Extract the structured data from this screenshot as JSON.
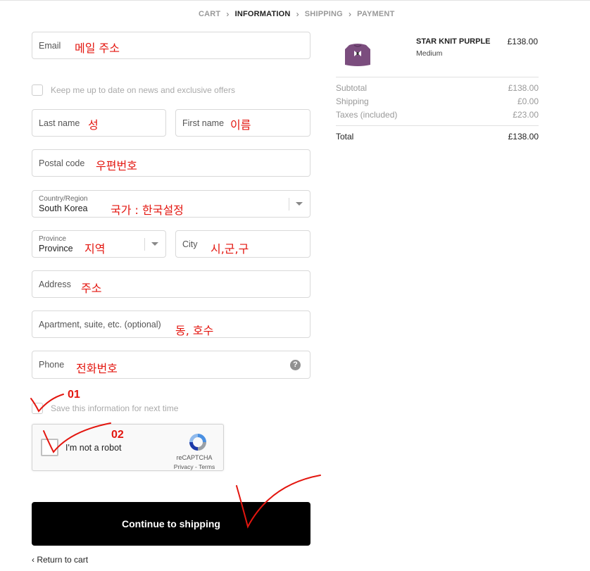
{
  "breadcrumb": [
    {
      "label": "CART",
      "active": false
    },
    {
      "label": "INFORMATION",
      "active": true
    },
    {
      "label": "SHIPPING",
      "active": false
    },
    {
      "label": "PAYMENT",
      "active": false
    }
  ],
  "form": {
    "email": {
      "placeholder": "Email",
      "annotation": "메일 주소"
    },
    "newsletter": {
      "label": "Keep me up to date on news and exclusive offers",
      "checked": false
    },
    "last_name": {
      "placeholder": "Last name",
      "annotation": "성"
    },
    "first_name": {
      "placeholder": "First name",
      "annotation": "이름"
    },
    "postal_code": {
      "placeholder": "Postal code",
      "annotation": "우편번호"
    },
    "country": {
      "label": "Country/Region",
      "value": "South Korea",
      "annotation": "국가 : 한국설정"
    },
    "province": {
      "label": "Province",
      "value": "Province",
      "annotation": "지역"
    },
    "city": {
      "placeholder": "City",
      "annotation": "시,군,구"
    },
    "address": {
      "placeholder": "Address",
      "annotation": "주소"
    },
    "apartment": {
      "placeholder": "Apartment, suite, etc. (optional)",
      "annotation": "동, 호수"
    },
    "phone": {
      "placeholder": "Phone",
      "annotation": "전화번호",
      "help_icon": "question-icon"
    },
    "save_info": {
      "label": "Save this information for next time",
      "checked": false,
      "annotation_number": "01"
    }
  },
  "captcha": {
    "label": "I'm not a robot",
    "brand": "reCAPTCHA",
    "links": "Privacy - Terms",
    "annotation_number": "02"
  },
  "actions": {
    "continue_label": "Continue to shipping",
    "return_label": "Return to cart"
  },
  "summary": {
    "product": {
      "name": "STAR KNIT PURPLE",
      "variant": "Medium",
      "price": "£138.00",
      "image_color": "#7b4d7e"
    },
    "rows": [
      {
        "label": "Subtotal",
        "value": "£138.00"
      },
      {
        "label": "Shipping",
        "value": "£0.00"
      },
      {
        "label": "Taxes (included)",
        "value": "£23.00"
      }
    ],
    "total": {
      "label": "Total",
      "value": "£138.00"
    }
  },
  "colors": {
    "annotation": "#e3160f",
    "button": "#000000"
  }
}
